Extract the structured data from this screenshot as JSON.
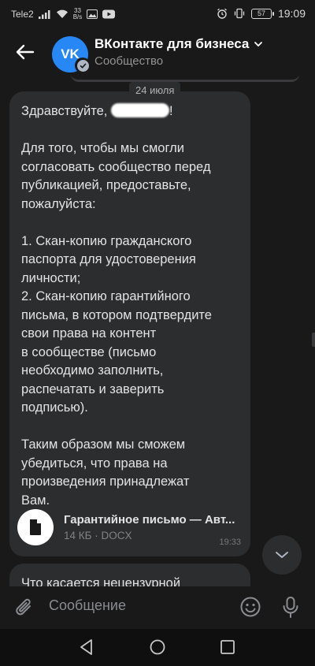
{
  "status_bar": {
    "carrier": "Tele2",
    "net_speed_value": "33",
    "net_speed_unit": "B/s",
    "battery": "57",
    "time": "19:09"
  },
  "header": {
    "title": "ВКонтакте для бизнеса",
    "subtitle": "Сообщество",
    "avatar_text": "VK"
  },
  "date_chip": "24 июля",
  "messages": [
    {
      "greeting": "Здравствуйте,",
      "greeting_end": "!",
      "body": "Для того, чтобы мы смогли\nсогласовать сообщество перед\nпубликацией, предоставьте,\nпожалуйста:\n\n1. Скан-копию гражданского\nпаспорта для удостоверения\nличности;\n2. Скан-копию гарантийного\nписьма, в котором подтвердите\nсвои права на контент\nв сообществе (письмо\nнеобходимо заполнить,\nраспечатать и заверить\nподписью).\n\nТаким образом мы сможем\nубедиться, что права на\nпроизведения принадлежат\nВам.",
      "attachment": {
        "name": "Гарантийное письмо — Авт...",
        "meta": "14 КБ · DOCX"
      },
      "time": "19:33"
    },
    {
      "body": "Что касается нецензурной"
    }
  ],
  "composer": {
    "placeholder": "Сообщение"
  },
  "colors": {
    "background": "#19191a",
    "bubble": "#2c2d2e",
    "accent": "#2787f5"
  }
}
